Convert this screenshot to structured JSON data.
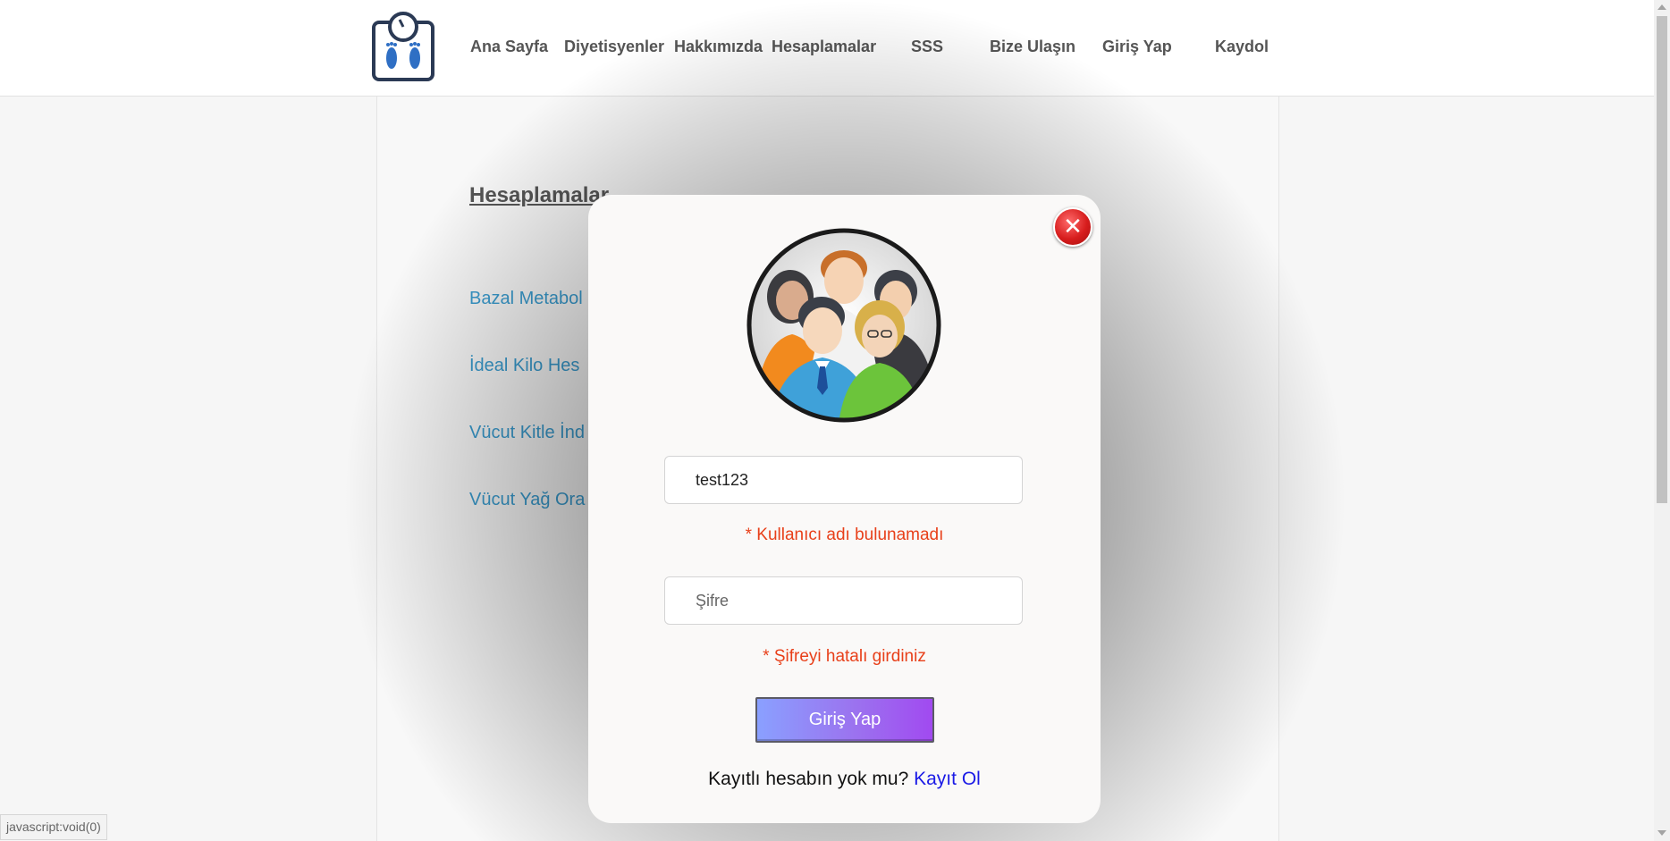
{
  "nav": {
    "items": [
      {
        "label": "Ana Sayfa"
      },
      {
        "label": "Diyetisyenler"
      },
      {
        "label": "Hakkımızda"
      },
      {
        "label": "Hesaplamalar"
      },
      {
        "label": "SSS"
      },
      {
        "label": "Bize Ulaşın"
      },
      {
        "label": "Giriş Yap"
      },
      {
        "label": "Kaydol"
      }
    ]
  },
  "page": {
    "title": "Hesaplamalar",
    "links": [
      {
        "label": "Bazal Metabol"
      },
      {
        "label": "İdeal Kilo Hes"
      },
      {
        "label": "Vücut Kitle İnd"
      },
      {
        "label": "Vücut Yağ Ora"
      }
    ]
  },
  "modal": {
    "username_value": "test123",
    "username_error": "* Kullanıcı adı bulunamadı",
    "password_placeholder": "Şifre",
    "password_error": "* Şifreyi hatalı girdiniz",
    "login_button": "Giriş Yap",
    "register_prompt": "Kayıtlı hesabın yok mu?",
    "register_link": "Kayıt Ol",
    "close_icon": "close-icon"
  },
  "status_bar": {
    "text": "javascript:void(0)"
  },
  "colors": {
    "link": "#3a9ccf",
    "error": "#e8401a",
    "register_link": "#1a1ae6",
    "button_gradient_start": "#8aa0ff",
    "button_gradient_end": "#a14af0"
  }
}
